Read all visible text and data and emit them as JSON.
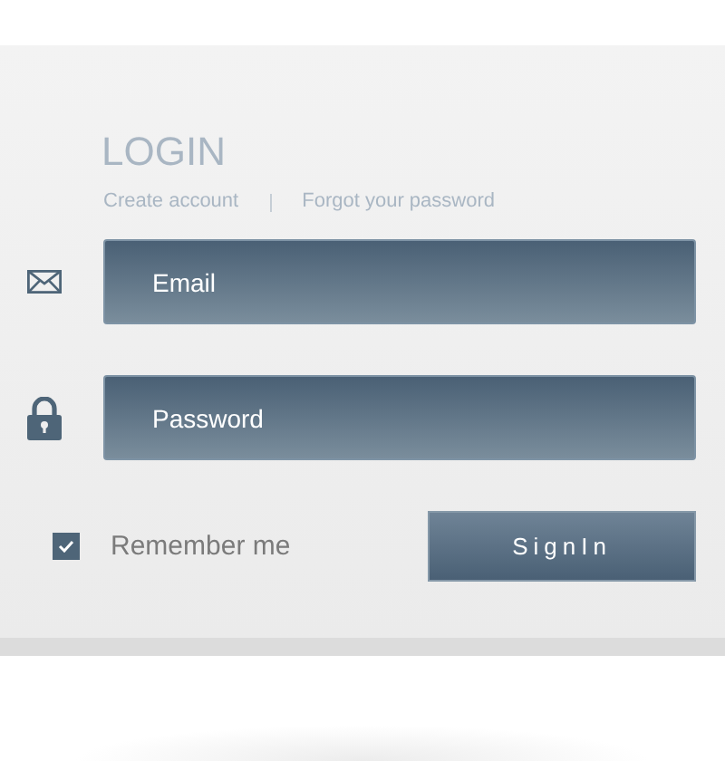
{
  "title": "LOGIN",
  "links": [
    "Create account",
    "Forgot your password"
  ],
  "fields": [
    {
      "kind": "email",
      "placeholder": "Email"
    },
    {
      "kind": "password",
      "placeholder": "Password"
    }
  ],
  "remember": {
    "label": "Remember me",
    "checked": true
  },
  "button": "SignIn"
}
